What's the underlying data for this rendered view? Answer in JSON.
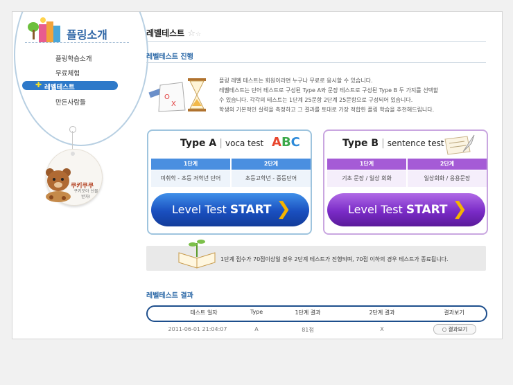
{
  "sidebar": {
    "title": "플링소개",
    "items": [
      {
        "label": "플링학습소개"
      },
      {
        "label": "무료체험"
      },
      {
        "label": "레벨테스트"
      },
      {
        "label": "만든사람들"
      }
    ],
    "tag_title": "쿠키쿠쿠",
    "tag_sub": "쿠키모아 선물받자!"
  },
  "page": {
    "title": "레벨테스트"
  },
  "section1": {
    "title": "레벨테스트 진행",
    "intro_lines": [
      "플링 레벨 테스트는 회원이라면 누구나 무료로 응시할 수 있습니다.",
      "레벨테스트는 단어 테스트로 구성된 Type A와 문장 테스트로 구성된 Type B 두 가지를 선택할",
      "수 있습니다. 각각의 테스트는 1단계 25문항 2단계 25문항으로 구성되어 있습니다.",
      "학생의 기본적인 실력을 측정하고 그 결과를 토대로 가장 적합한 플링 학습을 추천해드립니다."
    ]
  },
  "typeA": {
    "title": "Type A",
    "subtitle": "voca test",
    "stage1": "1단계",
    "stage2": "2단계",
    "desc1": "미취학 - 초등 저학년 단어",
    "desc2": "초등고학년 - 중등단어",
    "button_prefix": "Level Test",
    "button_main": "START",
    "color": "#1a4fbf"
  },
  "typeB": {
    "title": "Type B",
    "subtitle": "sentence test",
    "stage1": "1단계",
    "stage2": "2단계",
    "desc1": "기초 문장 / 일상 회화",
    "desc2": "일상회화 / 응용문장",
    "button_prefix": "Level Test",
    "button_main": "START",
    "color": "#7a2bc7"
  },
  "notice": {
    "text": "1단계 점수가 70점이상일 경우 2단계 테스트가 진행되며, 70점 이하의 경우 테스트가 종료됩니다."
  },
  "results": {
    "title": "레벨테스트 결과",
    "headers": [
      "테스트 일자",
      "Type",
      "1단계 결과",
      "2단계 결과",
      "결과보기"
    ],
    "rows": [
      {
        "date": "2011-06-01 21:04:07",
        "type": "A",
        "stage1": "81점",
        "stage2": "X",
        "view": "결과보기"
      }
    ]
  }
}
